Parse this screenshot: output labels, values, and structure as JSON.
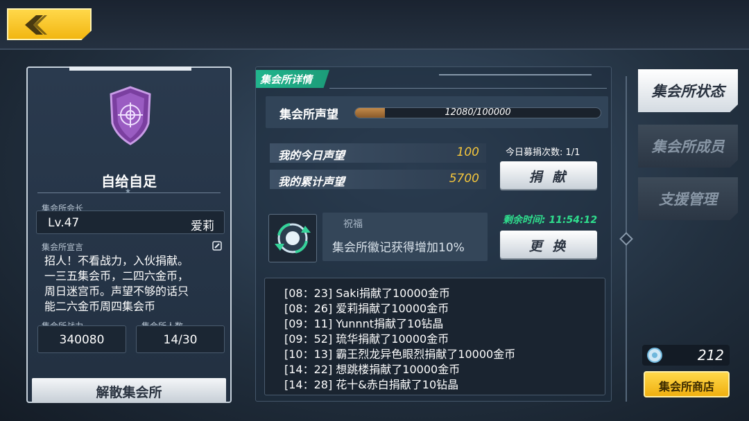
{
  "guild": {
    "name": "自给自足",
    "leader_label": "集会所会长",
    "leader_level": "Lv.47",
    "leader_name": "爱莉",
    "declaration_label": "集会所宣言",
    "declaration_lines": [
      "招人！不看战力，入伙捐献。",
      "一三五集会币，二四六金币，",
      "周日迷宫币。声望不够的话只",
      "能二六金币周四集会币"
    ],
    "power_label": "集会所战力",
    "power_value": "340080",
    "members_label": "集会所人数",
    "members_value": "14/30",
    "disband_label": "解散集会所"
  },
  "details": {
    "tab_label": "集会所详情",
    "reputation_label": "集会所声望",
    "reputation_text": "12080/100000",
    "reputation_fraction": 0.1208,
    "today_label": "我的今日声望",
    "today_value": "100",
    "total_label": "我的累计声望",
    "total_value": "5700",
    "donate_count": "今日募捐次数: 1/1",
    "donate_button": "捐 献",
    "blessing_title": "祝福",
    "blessing_desc": "集会所徽记获得增加10%",
    "remaining_time": "剩余时间: 11:54:12",
    "change_button": "更 换"
  },
  "log": [
    "[08：23] Saki捐献了10000金币",
    "[08：26] 爱莉捐献了10000金币",
    "[09：11] Yunnnt捐献了10钻晶",
    "[09：52] 琉华捐献了10000金币",
    "[10：13] 霸王烈龙异色眼烈捐献了10000金币",
    "[14：22] 想跳楼捐献了10000金币",
    "[14：28] 花十&赤白捐献了10钻晶"
  ],
  "tabs": {
    "status": "集会所状态",
    "members": "集会所成员",
    "support": "支援管理"
  },
  "currency": {
    "value": "212",
    "icon": "guild-coin-icon"
  },
  "shop_label": "集会所商店",
  "colors": {
    "accent_yellow": "#f2b611",
    "accent_green": "#21b58d",
    "highlight_value": "#f6c73c"
  }
}
